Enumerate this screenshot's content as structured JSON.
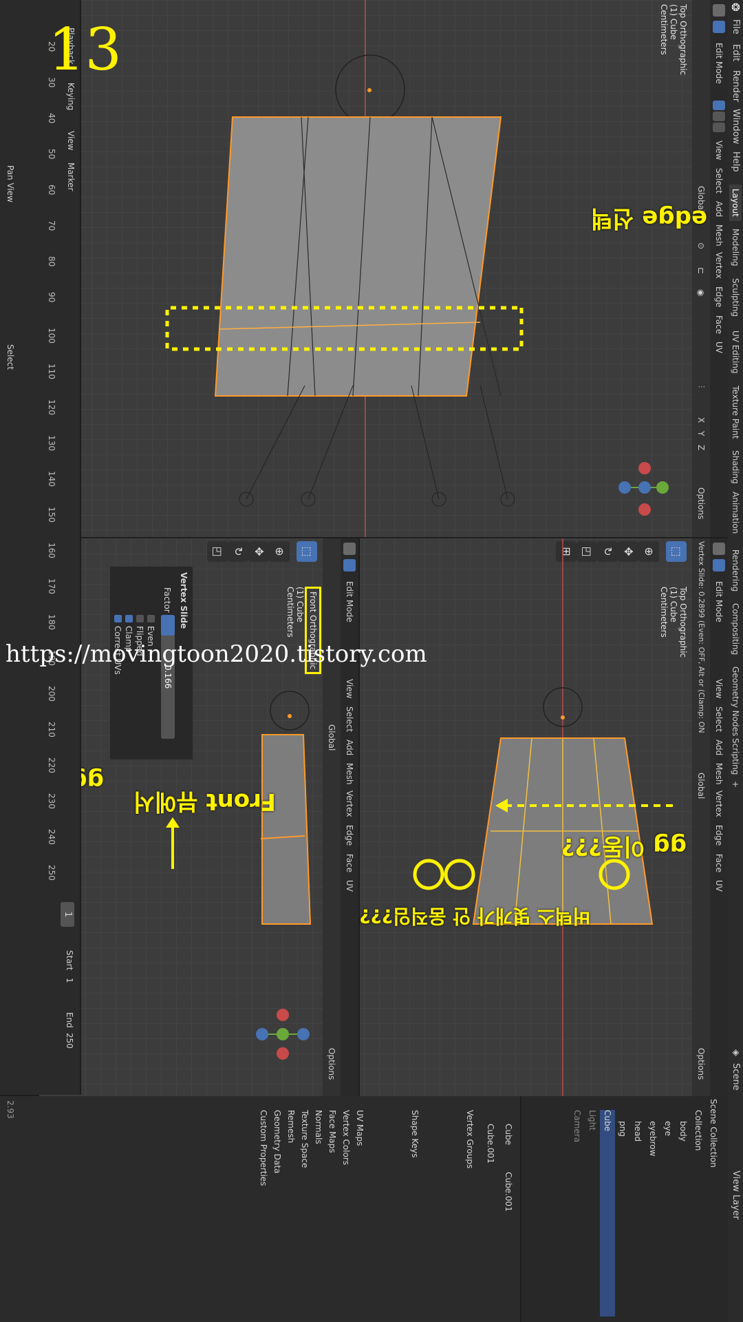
{
  "menu": [
    "File",
    "Edit",
    "Render",
    "Window",
    "Help"
  ],
  "workspaces": [
    "Layout",
    "Modeling",
    "Sculpting",
    "UV Editing",
    "Texture Paint",
    "Shading",
    "Animation",
    "Rendering",
    "Compositing",
    "Geometry Nodes",
    "Scripting"
  ],
  "workspace_add": "+",
  "scene_label": "Scene",
  "view_layer_label": "View Layer",
  "vp_top": {
    "mode": "Edit Mode",
    "menus": [
      "View",
      "Select",
      "Add",
      "Mesh",
      "Vertex",
      "Edge",
      "Face",
      "UV"
    ],
    "orientation": "Global",
    "options": "Options",
    "overlay_lines": [
      "Top Orthographic",
      "(1) Cube",
      "Centimeters"
    ],
    "annotation": "edge 선택"
  },
  "vp_right": {
    "mode": "Edit Mode",
    "menus": [
      "View",
      "Select",
      "Add",
      "Mesh",
      "Vertex",
      "Edge",
      "Face",
      "UV"
    ],
    "orientation": "Global",
    "options": "Options",
    "status_line": "Vertex Slide: 0.2899 (Even: OFF, Alt or (Clamp: ON",
    "overlay_lines": [
      "Top Orthographic",
      "(1) Cube",
      "Centimeters"
    ],
    "annotation_1": "gg 이동???",
    "annotation_2": "버택스 몇개가 안 움직임???"
  },
  "vp_left": {
    "mode": "Edit Mode",
    "menus": [
      "View",
      "Select",
      "Add",
      "Mesh",
      "Vertex",
      "Edge",
      "Face",
      "UV"
    ],
    "orientation": "Global",
    "options": "Options",
    "overlay_lines": [
      "Front Orthographic",
      "(1) Cube",
      "Centimeters"
    ],
    "annotation_1": "Front 뷰에서",
    "annotation_2": "gg 이동 잘됨",
    "operator_panel": {
      "title": "Vertex Slide",
      "factor_label": "Factor",
      "factor_value": "0.166",
      "factor_fraction": 0.166,
      "options": [
        {
          "label": "Even",
          "checked": false
        },
        {
          "label": "Flipped",
          "checked": false
        },
        {
          "label": "Clamp",
          "checked": true
        },
        {
          "label": "Correct UVs",
          "checked": true
        }
      ]
    }
  },
  "timeline": {
    "menus": [
      "Playback",
      "Keying",
      "View",
      "Marker"
    ],
    "frame_ticks": [
      "20",
      "30",
      "40",
      "50",
      "60",
      "70",
      "80",
      "90",
      "100",
      "110",
      "120",
      "130",
      "140",
      "150",
      "160",
      "170",
      "180",
      "190",
      "200",
      "210",
      "220",
      "230",
      "240",
      "250"
    ],
    "current_frame": "1",
    "start_label": "Start",
    "start_value": "1",
    "end_label": "End",
    "end_value": "250",
    "status_items": [
      "Pan View",
      "Select"
    ]
  },
  "overlay_number": "13",
  "watermark": "https://movingtoon2020.tistory.com",
  "outliner": {
    "rows": [
      {
        "label": "Scene Collection"
      },
      {
        "label": "Collection"
      },
      {
        "label": "body"
      },
      {
        "label": "eye"
      },
      {
        "label": "eyebrow"
      },
      {
        "label": "head"
      },
      {
        "label": "png"
      },
      {
        "label": "Cube"
      },
      {
        "label": "Light"
      },
      {
        "label": "Camera"
      }
    ]
  },
  "properties": {
    "breadcrumb": [
      "Cube",
      "Cube.001"
    ],
    "mesh_name": "Cube.001",
    "sections": [
      "Vertex Groups",
      "Shape Keys",
      "UV Maps",
      "Vertex Colors",
      "Face Maps",
      "Normals",
      "Texture Space",
      "Remesh",
      "Geometry Data",
      "Custom Properties"
    ]
  },
  "version": "2.93",
  "colors": {
    "accent": "#4772b3",
    "annotation_yellow": "#fff200",
    "selection_orange": "#ff9a2a",
    "viewport_bg": "#3c3c3c"
  }
}
